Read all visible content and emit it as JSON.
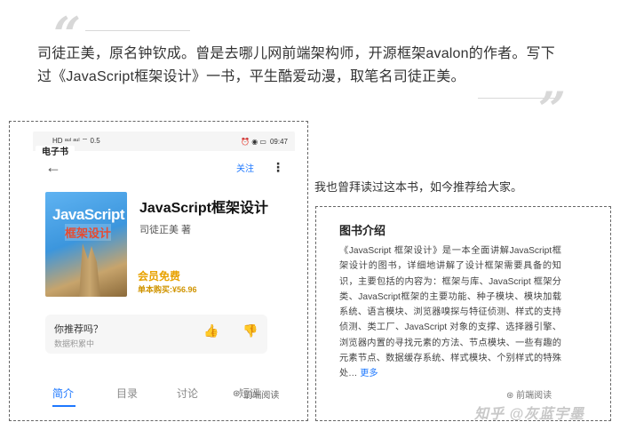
{
  "intro": {
    "line1": "司徒正美，原名钟钦成。曾是去哪儿网前端架构师，开源框架avalon的作者。写下",
    "line2": "过《JavaScript框架设计》一书，平生酷爱动漫，取笔名司徒正美。"
  },
  "quotes": {
    "open": "“",
    "close": "”"
  },
  "phone": {
    "status": {
      "left": "HD ᵃᵘˡ ᵃᵘˡ ⌔ 0.5",
      "time": "09:47",
      "right_icons": "⏰ ◉ ▭"
    },
    "appbar": {
      "back": "←",
      "follow": "关注",
      "more": "⋮"
    },
    "book": {
      "title": "JavaScript框架设计",
      "author": "司徒正美 著",
      "cover_title": "JavaScript",
      "cover_subtitle": "框架设计",
      "ebook_badge": "电子书",
      "vip": "会员免费",
      "price": "单本购买:¥56.96"
    },
    "recommend": {
      "question": "你推荐吗？",
      "sub": "数据积累中"
    },
    "tabs": [
      "简介",
      "目录",
      "讨论",
      "短评"
    ],
    "watermark": "前端阅读"
  },
  "recommend_text": "我也曾拜读过这本书，如今推荐给大家。",
  "book_intro": {
    "title": "图书介绍",
    "body": "《JavaScript 框架设计》是一本全面讲解JavaScript框架设计的图书，详细地讲解了设计框架需要具备的知识，主要包括的内容为：框架与库、JavaScript 框架分类、JavaScript框架的主要功能、种子模块、模块加载系统、语言模块、浏览器嗅探与特征侦测、样式的支持侦测、类工厂、JavaScript 对象的支撑、选择器引擎、浏览器内置的寻找元素的方法、节点模块、一些有趣的元素节点、数据缓存系统、样式模块、个别样式的特殊处…",
    "more": "更多"
  },
  "watermarks": {
    "zhihu": "知乎 @灰蓝宇墨",
    "gzh": "前端阅读"
  },
  "colors": {
    "accent": "#1e78ff",
    "vip": "#e8a200"
  }
}
